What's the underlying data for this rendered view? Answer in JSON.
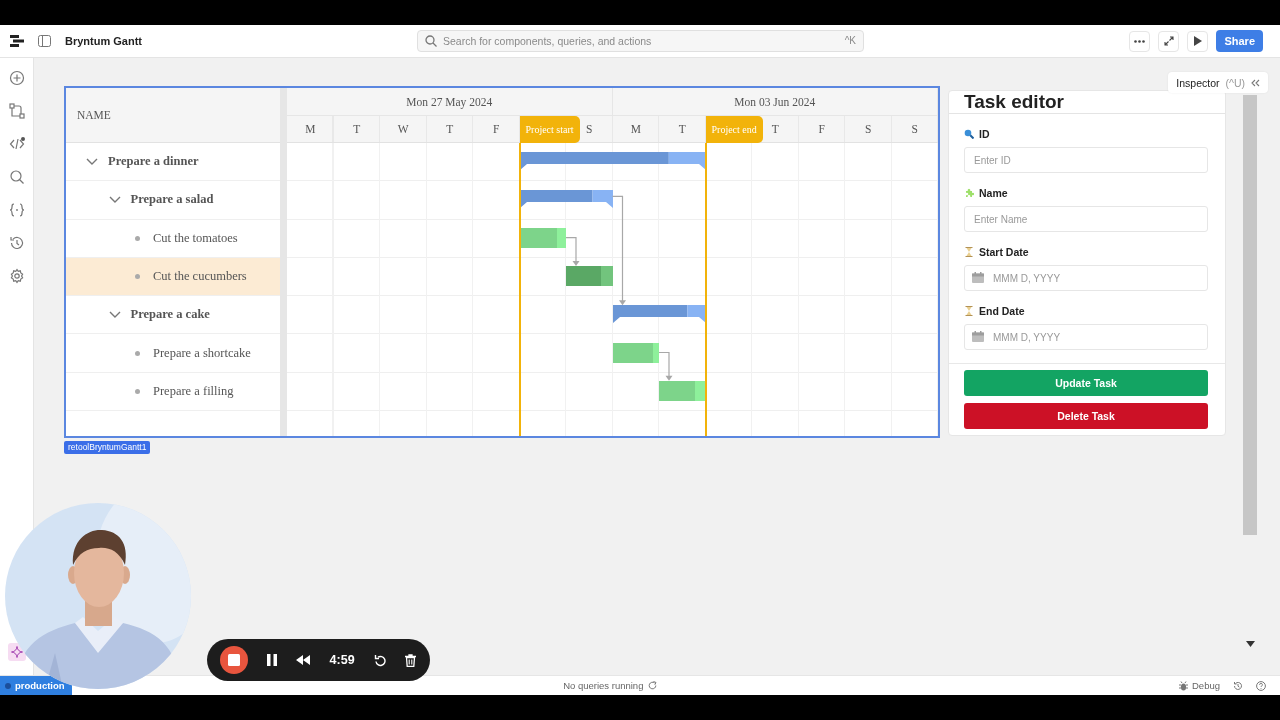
{
  "topbar": {
    "title": "Bryntum Gantt",
    "search_placeholder": "Search for components, queries, and actions",
    "search_shortcut": "^K",
    "share": "Share"
  },
  "inspector": {
    "label": "Inspector",
    "shortcut": "(^U)"
  },
  "gantt": {
    "name_header": "NAME",
    "weeks": [
      "Mon 27 May 2024",
      "Mon 03 Jun 2024"
    ],
    "days": [
      "M",
      "T",
      "W",
      "T",
      "F",
      "S",
      "M",
      "T",
      "T",
      "F",
      "S",
      "S"
    ],
    "markers": [
      {
        "label": "Project start"
      },
      {
        "label": "Project end"
      }
    ],
    "tasks": [
      {
        "name": "Prepare a dinner",
        "expanded": true,
        "selected": false,
        "level": 0.8,
        "children": [
          {
            "name": "Prepare a salad",
            "expanded": true,
            "selected": false,
            "level": 0.78,
            "children": [
              {
                "name": "Cut the tomatoes",
                "selected": false,
                "level": 0.8
              },
              {
                "name": "Cut the cucumbers",
                "selected": true,
                "level": 0.75
              }
            ]
          },
          {
            "name": "Prepare a cake",
            "expanded": true,
            "selected": false,
            "level": 0.8,
            "children": [
              {
                "name": "Prepare a shortcake",
                "selected": false,
                "level": 0.88
              },
              {
                "name": "Prepare a filling",
                "selected": false,
                "level": 0.78
              }
            ]
          }
        ]
      }
    ]
  },
  "component_tag": "retoolBryntumGantt1",
  "task_editor": {
    "title": "Task editor",
    "fields": [
      {
        "label": "ID",
        "kind": "text",
        "placeholder": "Enter ID"
      },
      {
        "label": "Name",
        "kind": "text",
        "placeholder": "Enter Name"
      },
      {
        "label": "Start Date",
        "kind": "date",
        "placeholder": "MMM D, YYYY"
      },
      {
        "label": "End Date",
        "kind": "date",
        "placeholder": "MMM D, YYYY"
      }
    ],
    "buttons": [
      {
        "label": "Update Task",
        "kind": "primary"
      },
      {
        "label": "Delete Task",
        "kind": "danger"
      }
    ]
  },
  "recorder": {
    "time": "4:59"
  },
  "status_bar": {
    "environment": "production",
    "queries": "No queries running",
    "debug": "Debug"
  }
}
